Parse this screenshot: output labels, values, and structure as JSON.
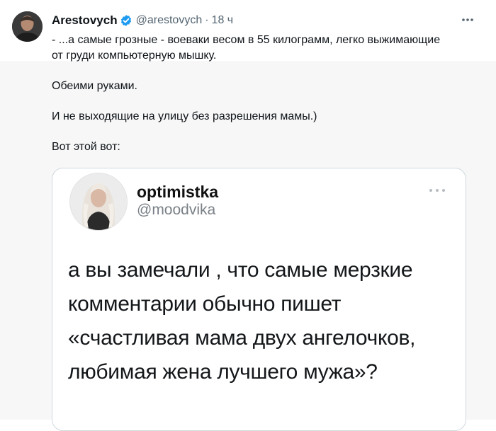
{
  "tweet": {
    "display_name": "Arestovych",
    "handle": "@arestovych",
    "separator": "·",
    "time": "18 ч",
    "body": [
      "- ...а самые грозные - воеваки весом в 55 килограмм, легко выжимающие",
      "от груди компьютерную мышку.",
      "Обеими руками.",
      "И не выходящие на улицу без разрешения мамы.)",
      "Вот этой вот:"
    ]
  },
  "quote": {
    "name": "optimistka",
    "handle": "@moodvika",
    "lines": [
      "а вы замечали , что самые мерзкие",
      "комментарии обычно пишет",
      "«счастливая мама двух ангелочков,",
      "любимая жена лучшего мужа»?"
    ]
  },
  "colors": {
    "verified": "#1d9bf0",
    "muted_text": "#536471",
    "band_background": "#f7f7f7",
    "card_border": "#cfd9de"
  },
  "icons": {
    "verified": "verified-badge-icon",
    "more": "more-horizontal-icon"
  }
}
